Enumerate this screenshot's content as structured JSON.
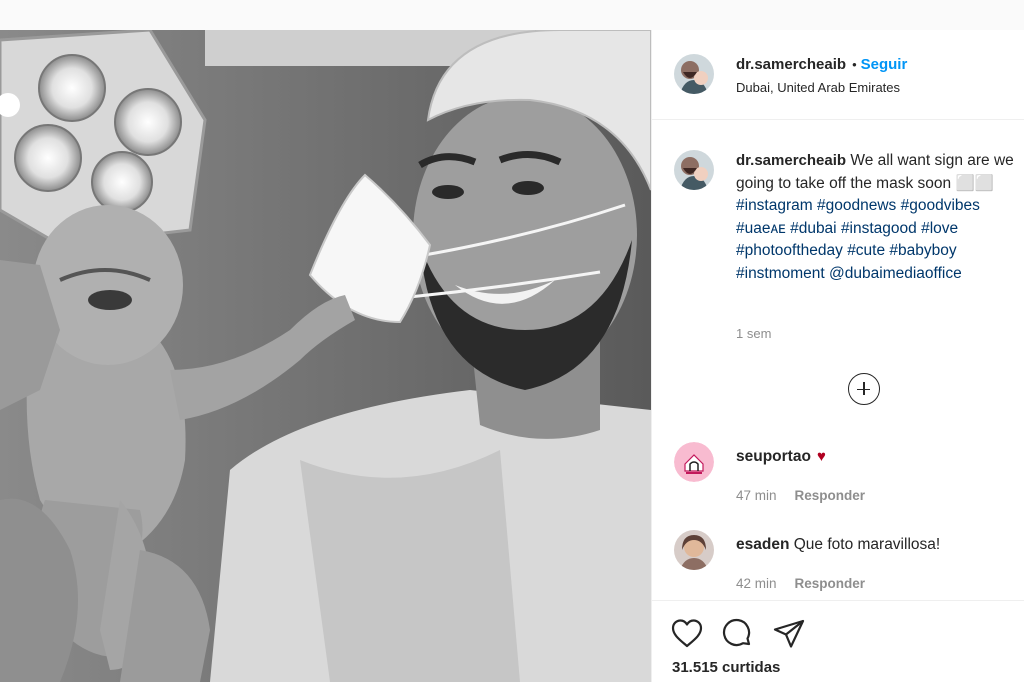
{
  "post": {
    "header": {
      "username": "dr.samercheaib",
      "separator": "•",
      "follow_label": "Seguir",
      "location": "Dubai, United Arab Emirates"
    },
    "caption": {
      "username": "dr.samercheaib",
      "text": "We all want sign are we going to take off the mask soon",
      "emoji": "⬜⬜",
      "hashtags": [
        "#instagram",
        "#goodnews",
        "#goodvibes",
        "#uaeᴀᴇ",
        "#dubai",
        "#instagood",
        "#love",
        "#photooftheday",
        "#cute",
        "#babyboy",
        "#instmoment"
      ],
      "mention": "@dubaimediaoffice",
      "time": "1 sem"
    },
    "comments": [
      {
        "username": "seuportao",
        "text": "",
        "time": "47 min",
        "reply_label": "Responder"
      },
      {
        "username": "esaden",
        "text": "Que foto maravillosa!",
        "time": "42 min",
        "reply_label": "Responder"
      }
    ],
    "actions": {
      "like_icon": "heart-icon",
      "comment_icon": "comment-icon",
      "share_icon": "paper-plane-icon"
    },
    "likes_text": "31.515 curtidas"
  }
}
